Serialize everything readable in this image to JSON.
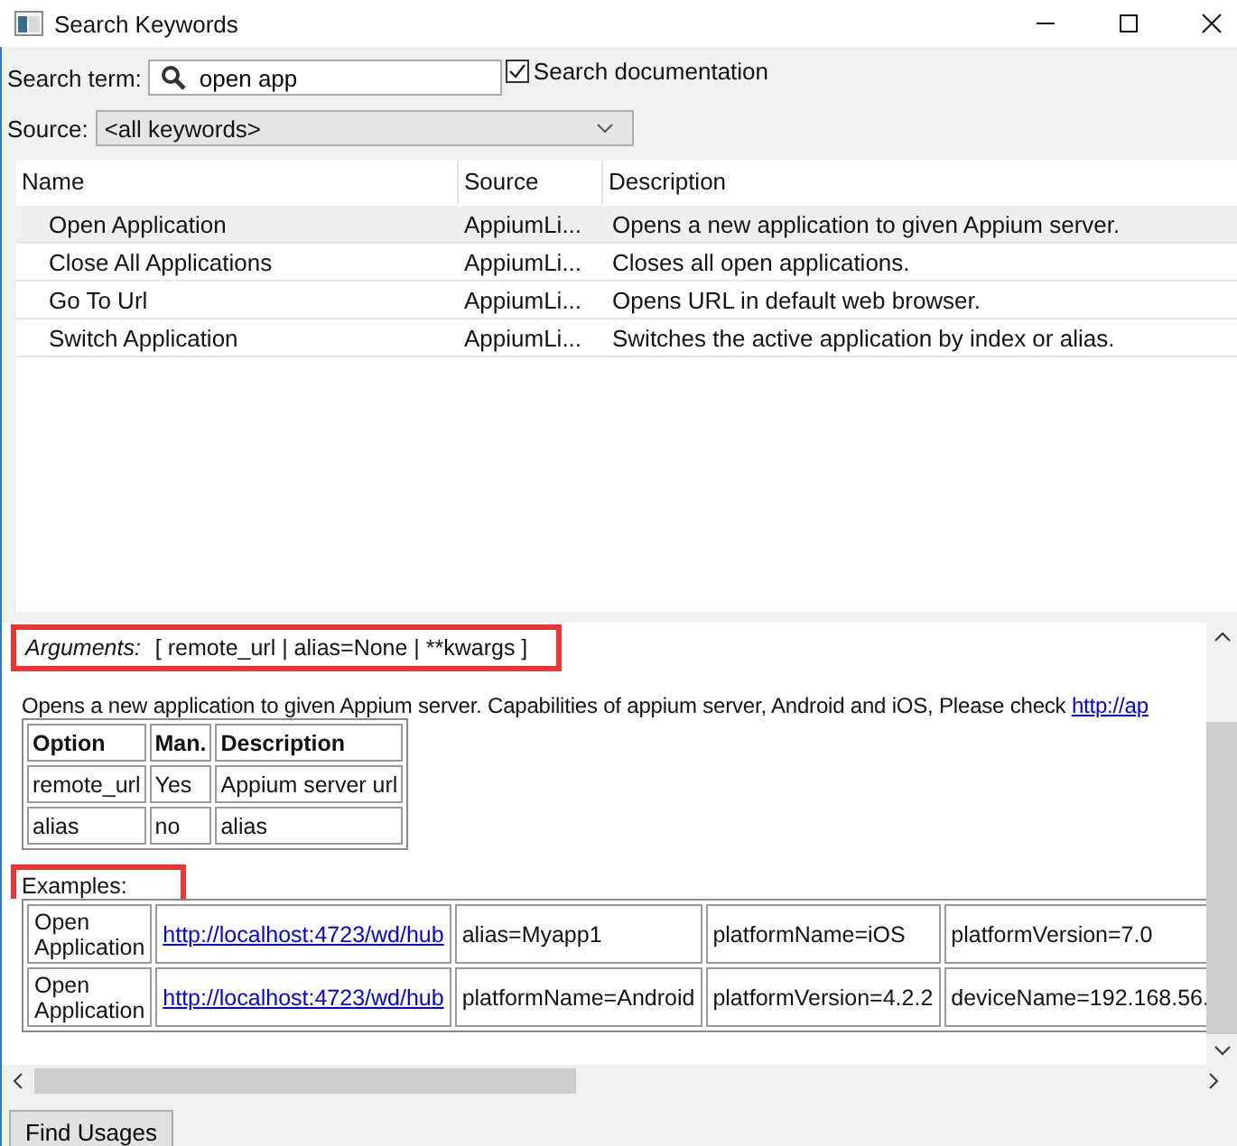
{
  "window": {
    "title": "Search Keywords"
  },
  "search": {
    "label": "Search term:",
    "value": "open app"
  },
  "search_documentation": {
    "label": "Search documentation",
    "checked": true
  },
  "source": {
    "label": "Source:",
    "value": "<all keywords>"
  },
  "keywords": {
    "columns": [
      "Name",
      "Source",
      "Description"
    ],
    "rows": [
      {
        "name": "Open Application",
        "source": "AppiumLi...",
        "description": "Opens a new application to given Appium server.",
        "selected": true
      },
      {
        "name": "Close All Applications",
        "source": "AppiumLi...",
        "description": "Closes all open applications.",
        "selected": false
      },
      {
        "name": "Go To Url",
        "source": "AppiumLi...",
        "description": "Opens URL in default web browser.",
        "selected": false
      },
      {
        "name": "Switch Application",
        "source": "AppiumLi...",
        "description": "Switches the active application by index or alias.",
        "selected": false
      }
    ]
  },
  "documentation": {
    "arguments": {
      "label": "Arguments:",
      "value": "[ remote_url | alias=None | **kwargs ]",
      "highlighted": true
    },
    "text": "Opens a new application to given Appium server. Capabilities of appium server, Android and iOS, Please check",
    "link": "http://ap",
    "options": {
      "columns": [
        "Option",
        "Man.",
        "Description"
      ],
      "rows": [
        [
          "remote_url",
          "Yes",
          "Appium server url"
        ],
        [
          "alias",
          "no",
          "alias"
        ]
      ]
    },
    "examples_label": {
      "text": "Examples:",
      "highlighted": true
    },
    "examples": [
      [
        {
          "kind": "text",
          "text": "Open Application"
        },
        {
          "kind": "link",
          "text": "http://localhost:4723/wd/hub"
        },
        {
          "kind": "text",
          "text": "alias=Myapp1"
        },
        {
          "kind": "text",
          "text": "platformName=iOS"
        },
        {
          "kind": "text",
          "text": "platformVersion=7.0"
        }
      ],
      [
        {
          "kind": "text",
          "text": "Open Application"
        },
        {
          "kind": "link",
          "text": "http://localhost:4723/wd/hub"
        },
        {
          "kind": "text",
          "text": "platformName=Android"
        },
        {
          "kind": "text",
          "text": "platformVersion=4.2.2"
        },
        {
          "kind": "text",
          "text": "deviceName=192.168.56."
        }
      ]
    ]
  },
  "buttons": [
    "Find Usages"
  ]
}
